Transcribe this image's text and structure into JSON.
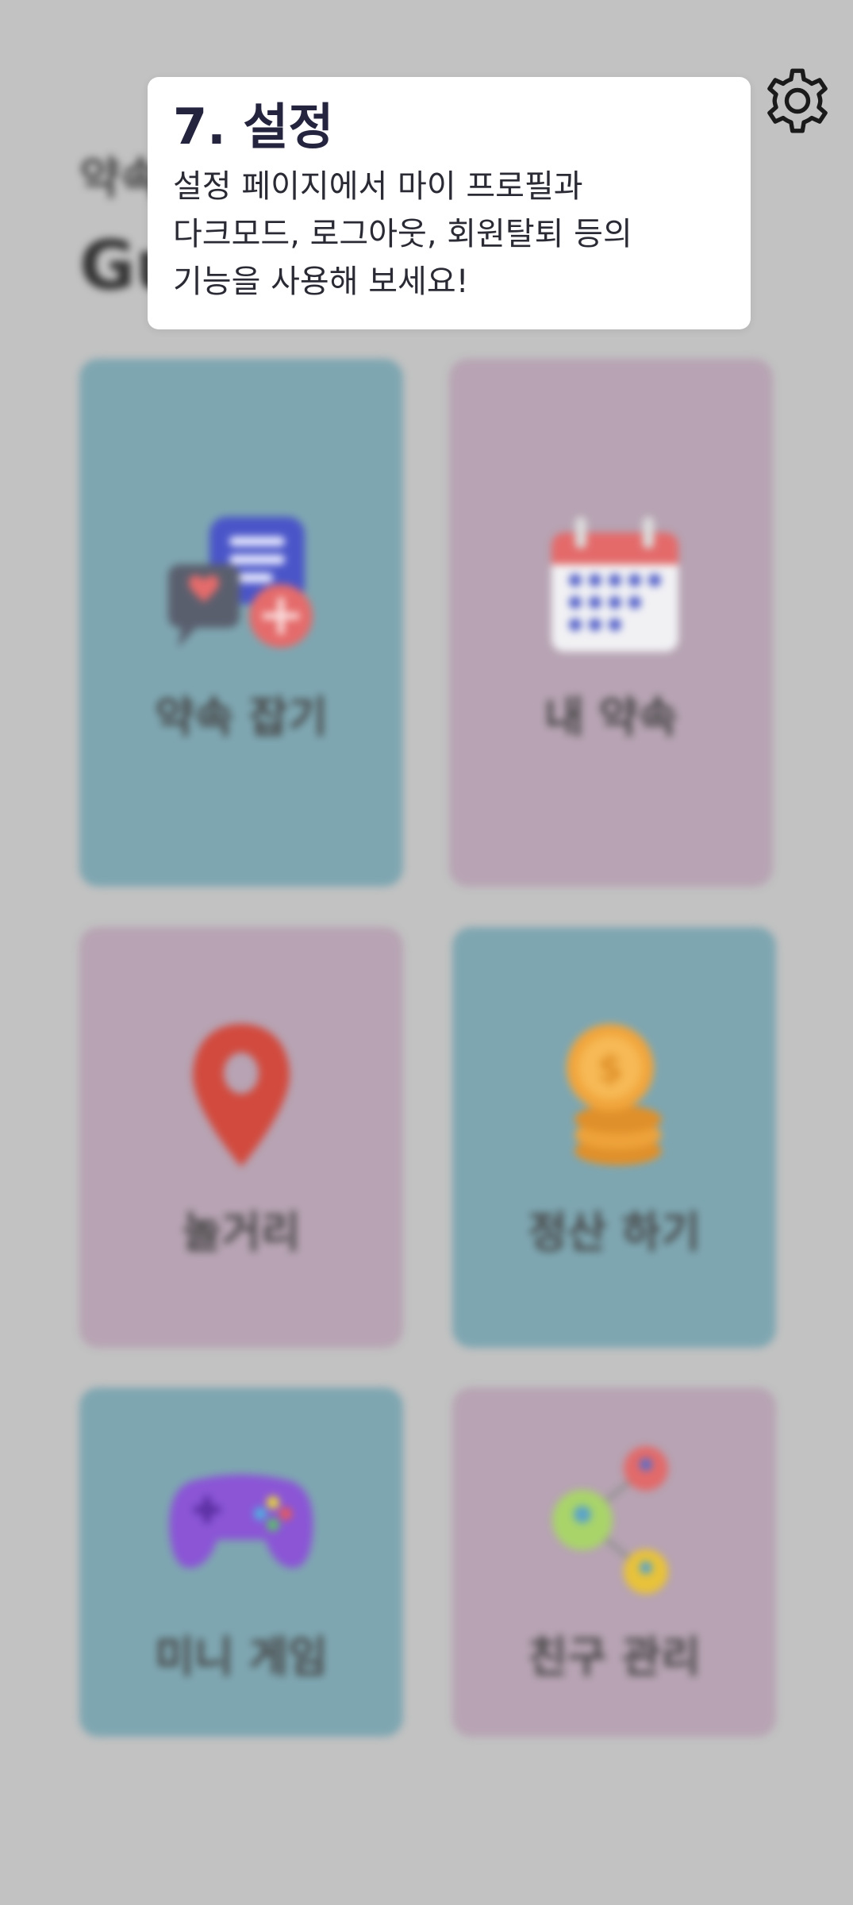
{
  "header": {
    "subtitle": "약속",
    "greeting": "Gu"
  },
  "cards": [
    {
      "label": "약속 잡기",
      "icon": "chat-bubbles-plus-icon",
      "color": "#7ea6b1"
    },
    {
      "label": "내 약속",
      "icon": "calendar-icon",
      "color": "#b7a3b3"
    },
    {
      "label": "놀거리",
      "icon": "map-pin-icon",
      "color": "#b7a3b3"
    },
    {
      "label": "정산 하기",
      "icon": "coins-icon",
      "color": "#7ea6b1"
    },
    {
      "label": "미니 게임",
      "icon": "gamepad-icon",
      "color": "#7ea6b1"
    },
    {
      "label": "친구 관리",
      "icon": "friends-network-icon",
      "color": "#b7a3b3"
    }
  ],
  "tooltip": {
    "title": "7. 설정",
    "lines": [
      "설정 페이지에서 마이 프로필과",
      "다크모드, 로그아웃, 회원탈퇴 등의",
      "기능을 사용해 보세요!"
    ]
  },
  "settings_icon": "gear-icon"
}
